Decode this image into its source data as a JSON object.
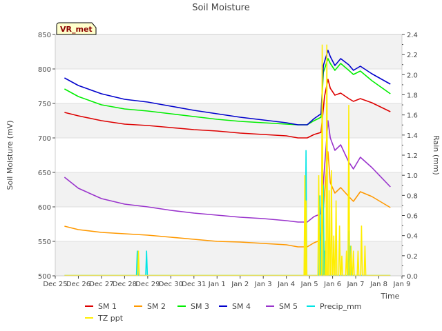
{
  "chart_data": {
    "type": "line",
    "title": "Soil Moisture",
    "badge": "VR_met",
    "xlabel": "Time",
    "ylabel": "Soil Moisture (mV)",
    "y2label": "Rain (mm)",
    "ylim": [
      500,
      850
    ],
    "y2lim": [
      0,
      2.4
    ],
    "yticks": [
      500,
      550,
      600,
      650,
      700,
      750,
      800,
      850
    ],
    "y2ticks": [
      "0.0",
      "0.2",
      "0.4",
      "0.6",
      "0.8",
      "1.0",
      "1.2",
      "1.4",
      "1.6",
      "1.8",
      "2.0",
      "2.2",
      "2.4"
    ],
    "xlim": [
      0,
      15
    ],
    "xticks": [
      {
        "v": 0,
        "label": "Dec 25"
      },
      {
        "v": 1,
        "label": "Dec 26"
      },
      {
        "v": 2,
        "label": "Dec 27"
      },
      {
        "v": 3,
        "label": "Dec 28"
      },
      {
        "v": 4,
        "label": "Dec 29"
      },
      {
        "v": 5,
        "label": "Dec 30"
      },
      {
        "v": 6,
        "label": "Dec 31"
      },
      {
        "v": 7,
        "label": "Jan 1"
      },
      {
        "v": 8,
        "label": "Jan 2"
      },
      {
        "v": 9,
        "label": "Jan 3"
      },
      {
        "v": 10,
        "label": "Jan 4"
      },
      {
        "v": 11,
        "label": "Jan 5"
      },
      {
        "v": 12,
        "label": "Jan 6"
      },
      {
        "v": 13,
        "label": "Jan 7"
      },
      {
        "v": 14,
        "label": "Jan 8"
      },
      {
        "v": 15,
        "label": "Jan 9"
      }
    ],
    "grid": true,
    "legend": "bottom",
    "series": [
      {
        "name": "SM 1",
        "color": "#dd0000",
        "axis": "left",
        "x": [
          0.4,
          1,
          2,
          3,
          4,
          5,
          6,
          7,
          8,
          9,
          10,
          10.5,
          10.9,
          11.2,
          11.5,
          11.65,
          11.8,
          11.9,
          12.1,
          12.35,
          12.7,
          12.9,
          13.2,
          13.7,
          14.5
        ],
        "y": [
          737,
          732,
          725,
          720,
          718,
          715,
          712,
          710,
          707,
          705,
          703,
          700,
          700,
          705,
          708,
          760,
          785,
          772,
          762,
          765,
          757,
          753,
          757,
          751,
          738
        ]
      },
      {
        "name": "SM 2",
        "color": "#ff9900",
        "axis": "left",
        "x": [
          0.4,
          1,
          2,
          3,
          4,
          5,
          6,
          7,
          8,
          9,
          10,
          10.5,
          10.9,
          11.2,
          11.5,
          11.7,
          11.8,
          11.9,
          12.1,
          12.35,
          12.7,
          12.9,
          13.2,
          13.7,
          14.5
        ],
        "y": [
          572,
          567,
          563,
          561,
          559,
          556,
          553,
          550,
          549,
          547,
          545,
          542,
          542,
          548,
          552,
          640,
          680,
          635,
          620,
          628,
          615,
          608,
          622,
          615,
          599
        ]
      },
      {
        "name": "SM 3",
        "color": "#00ee00",
        "axis": "left",
        "x": [
          0.4,
          1,
          2,
          3,
          4,
          5,
          6,
          7,
          8,
          9,
          10,
          10.5,
          10.9,
          11.2,
          11.5,
          11.6,
          11.8,
          11.9,
          12.1,
          12.35,
          12.7,
          12.9,
          13.2,
          13.7,
          14.5
        ],
        "y": [
          771,
          760,
          748,
          742,
          739,
          735,
          731,
          727,
          724,
          722,
          720,
          719,
          719,
          725,
          730,
          795,
          815,
          808,
          798,
          808,
          798,
          792,
          797,
          783,
          764
        ]
      },
      {
        "name": "SM 4",
        "color": "#0000cc",
        "axis": "left",
        "x": [
          0.4,
          1,
          2,
          3,
          4,
          5,
          6,
          7,
          8,
          9,
          10,
          10.5,
          10.9,
          11.2,
          11.5,
          11.6,
          11.8,
          11.9,
          12.1,
          12.35,
          12.7,
          12.9,
          13.2,
          13.7,
          14.5
        ],
        "y": [
          787,
          776,
          764,
          756,
          752,
          746,
          740,
          735,
          730,
          726,
          722,
          719,
          719,
          728,
          735,
          805,
          827,
          818,
          805,
          815,
          806,
          798,
          804,
          793,
          778
        ]
      },
      {
        "name": "SM 5",
        "color": "#9933cc",
        "axis": "left",
        "x": [
          0.4,
          1,
          2,
          3,
          4,
          5,
          6,
          7,
          8,
          9,
          10,
          10.5,
          10.9,
          11.2,
          11.5,
          11.7,
          11.8,
          11.9,
          12.1,
          12.35,
          12.7,
          12.9,
          13.2,
          13.7,
          14.5
        ],
        "y": [
          643,
          627,
          612,
          604,
          600,
          595,
          591,
          588,
          585,
          583,
          580,
          578,
          578,
          586,
          590,
          680,
          725,
          700,
          682,
          690,
          665,
          655,
          672,
          657,
          629
        ]
      },
      {
        "name": "Precip_mm",
        "color": "#00e5e5",
        "axis": "right",
        "kind": "spikes",
        "x": [
          3.55,
          3.95,
          10.85,
          11.45,
          11.6,
          11.65,
          12.7,
          12.75
        ],
        "y": [
          0.25,
          0.25,
          1.25,
          0.8,
          0.9,
          0.25,
          0.45,
          0.3
        ]
      },
      {
        "name": "TZ ppt",
        "color": "#ffee00",
        "axis": "right",
        "kind": "spikes",
        "x": [
          3.6,
          10.8,
          10.85,
          11.4,
          11.55,
          11.7,
          11.75,
          11.85,
          11.95,
          12.05,
          12.15,
          12.3,
          12.4,
          12.6,
          12.7,
          12.8,
          12.9,
          13.1,
          13.25,
          13.4
        ],
        "y": [
          0.25,
          1.0,
          0.75,
          1.0,
          2.3,
          0.35,
          2.3,
          0.85,
          1.05,
          0.4,
          0.75,
          0.5,
          0.2,
          0.25,
          1.7,
          0.3,
          0.25,
          0.25,
          0.5,
          0.3
        ]
      }
    ]
  }
}
